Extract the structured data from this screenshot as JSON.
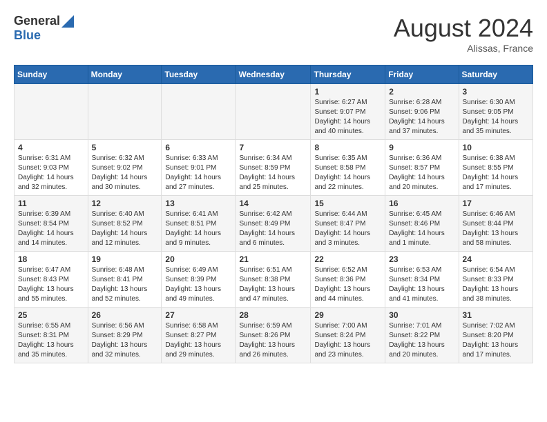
{
  "header": {
    "logo_general": "General",
    "logo_blue": "Blue",
    "main_title": "August 2024",
    "subtitle": "Alissas, France"
  },
  "weekdays": [
    "Sunday",
    "Monday",
    "Tuesday",
    "Wednesday",
    "Thursday",
    "Friday",
    "Saturday"
  ],
  "weeks": [
    [
      {
        "day": "",
        "sunrise": "",
        "sunset": "",
        "daylight": ""
      },
      {
        "day": "",
        "sunrise": "",
        "sunset": "",
        "daylight": ""
      },
      {
        "day": "",
        "sunrise": "",
        "sunset": "",
        "daylight": ""
      },
      {
        "day": "",
        "sunrise": "",
        "sunset": "",
        "daylight": ""
      },
      {
        "day": "1",
        "sunrise": "Sunrise: 6:27 AM",
        "sunset": "Sunset: 9:07 PM",
        "daylight": "Daylight: 14 hours and 40 minutes."
      },
      {
        "day": "2",
        "sunrise": "Sunrise: 6:28 AM",
        "sunset": "Sunset: 9:06 PM",
        "daylight": "Daylight: 14 hours and 37 minutes."
      },
      {
        "day": "3",
        "sunrise": "Sunrise: 6:30 AM",
        "sunset": "Sunset: 9:05 PM",
        "daylight": "Daylight: 14 hours and 35 minutes."
      }
    ],
    [
      {
        "day": "4",
        "sunrise": "Sunrise: 6:31 AM",
        "sunset": "Sunset: 9:03 PM",
        "daylight": "Daylight: 14 hours and 32 minutes."
      },
      {
        "day": "5",
        "sunrise": "Sunrise: 6:32 AM",
        "sunset": "Sunset: 9:02 PM",
        "daylight": "Daylight: 14 hours and 30 minutes."
      },
      {
        "day": "6",
        "sunrise": "Sunrise: 6:33 AM",
        "sunset": "Sunset: 9:01 PM",
        "daylight": "Daylight: 14 hours and 27 minutes."
      },
      {
        "day": "7",
        "sunrise": "Sunrise: 6:34 AM",
        "sunset": "Sunset: 8:59 PM",
        "daylight": "Daylight: 14 hours and 25 minutes."
      },
      {
        "day": "8",
        "sunrise": "Sunrise: 6:35 AM",
        "sunset": "Sunset: 8:58 PM",
        "daylight": "Daylight: 14 hours and 22 minutes."
      },
      {
        "day": "9",
        "sunrise": "Sunrise: 6:36 AM",
        "sunset": "Sunset: 8:57 PM",
        "daylight": "Daylight: 14 hours and 20 minutes."
      },
      {
        "day": "10",
        "sunrise": "Sunrise: 6:38 AM",
        "sunset": "Sunset: 8:55 PM",
        "daylight": "Daylight: 14 hours and 17 minutes."
      }
    ],
    [
      {
        "day": "11",
        "sunrise": "Sunrise: 6:39 AM",
        "sunset": "Sunset: 8:54 PM",
        "daylight": "Daylight: 14 hours and 14 minutes."
      },
      {
        "day": "12",
        "sunrise": "Sunrise: 6:40 AM",
        "sunset": "Sunset: 8:52 PM",
        "daylight": "Daylight: 14 hours and 12 minutes."
      },
      {
        "day": "13",
        "sunrise": "Sunrise: 6:41 AM",
        "sunset": "Sunset: 8:51 PM",
        "daylight": "Daylight: 14 hours and 9 minutes."
      },
      {
        "day": "14",
        "sunrise": "Sunrise: 6:42 AM",
        "sunset": "Sunset: 8:49 PM",
        "daylight": "Daylight: 14 hours and 6 minutes."
      },
      {
        "day": "15",
        "sunrise": "Sunrise: 6:44 AM",
        "sunset": "Sunset: 8:47 PM",
        "daylight": "Daylight: 14 hours and 3 minutes."
      },
      {
        "day": "16",
        "sunrise": "Sunrise: 6:45 AM",
        "sunset": "Sunset: 8:46 PM",
        "daylight": "Daylight: 14 hours and 1 minute."
      },
      {
        "day": "17",
        "sunrise": "Sunrise: 6:46 AM",
        "sunset": "Sunset: 8:44 PM",
        "daylight": "Daylight: 13 hours and 58 minutes."
      }
    ],
    [
      {
        "day": "18",
        "sunrise": "Sunrise: 6:47 AM",
        "sunset": "Sunset: 8:43 PM",
        "daylight": "Daylight: 13 hours and 55 minutes."
      },
      {
        "day": "19",
        "sunrise": "Sunrise: 6:48 AM",
        "sunset": "Sunset: 8:41 PM",
        "daylight": "Daylight: 13 hours and 52 minutes."
      },
      {
        "day": "20",
        "sunrise": "Sunrise: 6:49 AM",
        "sunset": "Sunset: 8:39 PM",
        "daylight": "Daylight: 13 hours and 49 minutes."
      },
      {
        "day": "21",
        "sunrise": "Sunrise: 6:51 AM",
        "sunset": "Sunset: 8:38 PM",
        "daylight": "Daylight: 13 hours and 47 minutes."
      },
      {
        "day": "22",
        "sunrise": "Sunrise: 6:52 AM",
        "sunset": "Sunset: 8:36 PM",
        "daylight": "Daylight: 13 hours and 44 minutes."
      },
      {
        "day": "23",
        "sunrise": "Sunrise: 6:53 AM",
        "sunset": "Sunset: 8:34 PM",
        "daylight": "Daylight: 13 hours and 41 minutes."
      },
      {
        "day": "24",
        "sunrise": "Sunrise: 6:54 AM",
        "sunset": "Sunset: 8:33 PM",
        "daylight": "Daylight: 13 hours and 38 minutes."
      }
    ],
    [
      {
        "day": "25",
        "sunrise": "Sunrise: 6:55 AM",
        "sunset": "Sunset: 8:31 PM",
        "daylight": "Daylight: 13 hours and 35 minutes."
      },
      {
        "day": "26",
        "sunrise": "Sunrise: 6:56 AM",
        "sunset": "Sunset: 8:29 PM",
        "daylight": "Daylight: 13 hours and 32 minutes."
      },
      {
        "day": "27",
        "sunrise": "Sunrise: 6:58 AM",
        "sunset": "Sunset: 8:27 PM",
        "daylight": "Daylight: 13 hours and 29 minutes."
      },
      {
        "day": "28",
        "sunrise": "Sunrise: 6:59 AM",
        "sunset": "Sunset: 8:26 PM",
        "daylight": "Daylight: 13 hours and 26 minutes."
      },
      {
        "day": "29",
        "sunrise": "Sunrise: 7:00 AM",
        "sunset": "Sunset: 8:24 PM",
        "daylight": "Daylight: 13 hours and 23 minutes."
      },
      {
        "day": "30",
        "sunrise": "Sunrise: 7:01 AM",
        "sunset": "Sunset: 8:22 PM",
        "daylight": "Daylight: 13 hours and 20 minutes."
      },
      {
        "day": "31",
        "sunrise": "Sunrise: 7:02 AM",
        "sunset": "Sunset: 8:20 PM",
        "daylight": "Daylight: 13 hours and 17 minutes."
      }
    ]
  ]
}
